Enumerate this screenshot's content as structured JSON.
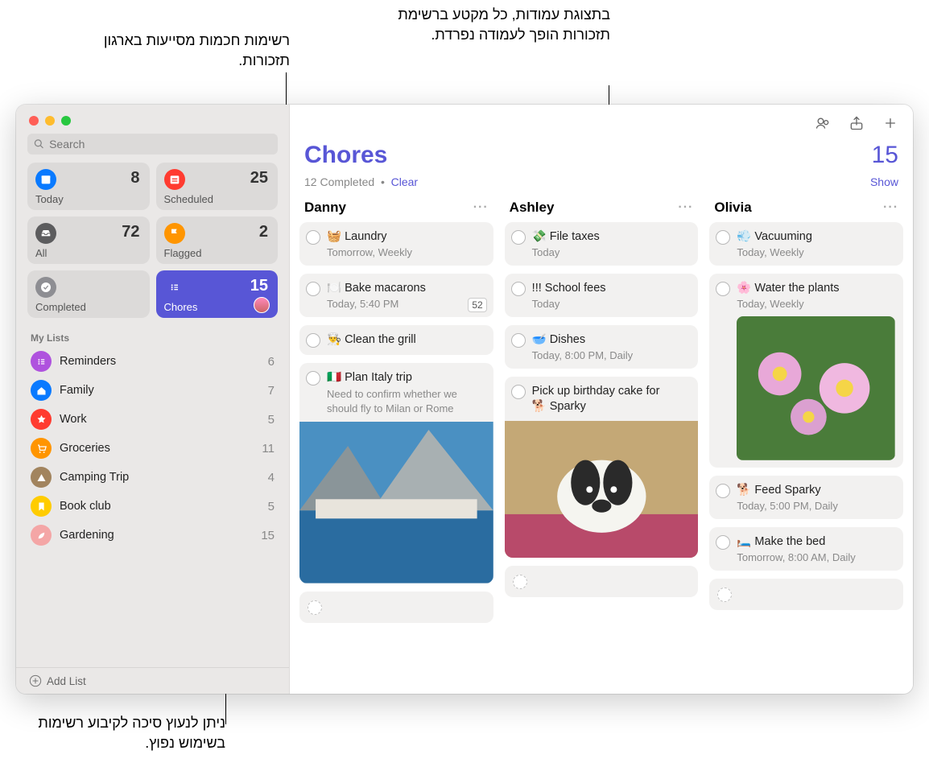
{
  "callouts": {
    "top_right": "בתצוגת עמודות, כל מקטע ברשימת תזכורות הופך לעמודה נפרדת.",
    "top_left": "רשימות חכמות מסייעות בארגון תזכורות.",
    "bottom": "ניתן לנעוץ סיכה לקיבוע רשימות בשימוש נפוץ."
  },
  "search": {
    "placeholder": "Search"
  },
  "smart": [
    {
      "id": "today",
      "label": "Today",
      "count": "8",
      "icon_bg": "#0a7aff",
      "glyph": "calendar"
    },
    {
      "id": "scheduled",
      "label": "Scheduled",
      "count": "25",
      "icon_bg": "#ff3b30",
      "glyph": "calendar-lines"
    },
    {
      "id": "all",
      "label": "All",
      "count": "72",
      "icon_bg": "#5c5c5e",
      "glyph": "tray"
    },
    {
      "id": "flagged",
      "label": "Flagged",
      "count": "2",
      "icon_bg": "#ff9500",
      "glyph": "flag"
    },
    {
      "id": "completed",
      "label": "Completed",
      "count": "",
      "icon_bg": "#8e8e93",
      "glyph": "check"
    },
    {
      "id": "chores",
      "label": "Chores",
      "count": "15",
      "icon_bg": "#5856d6",
      "glyph": "list",
      "active": true,
      "avatar": true
    }
  ],
  "my_lists_label": "My Lists",
  "lists": [
    {
      "name": "Reminders",
      "count": "6",
      "color": "#af52de",
      "glyph": "list"
    },
    {
      "name": "Family",
      "count": "7",
      "color": "#0a7aff",
      "glyph": "house"
    },
    {
      "name": "Work",
      "count": "5",
      "color": "#ff3b30",
      "glyph": "star"
    },
    {
      "name": "Groceries",
      "count": "11",
      "color": "#ff9500",
      "glyph": "cart"
    },
    {
      "name": "Camping Trip",
      "count": "4",
      "color": "#a2845e",
      "glyph": "tent"
    },
    {
      "name": "Book club",
      "count": "5",
      "color": "#ffcc00",
      "glyph": "bookmark"
    },
    {
      "name": "Gardening",
      "count": "15",
      "color": "#f4a6a6",
      "glyph": "leaf"
    }
  ],
  "add_list_label": "Add List",
  "main": {
    "title": "Chores",
    "count": "15",
    "completed_text": "12 Completed",
    "clear_label": "Clear",
    "show_label": "Show"
  },
  "columns": [
    {
      "name": "Danny",
      "cards": [
        {
          "emoji": "🧺",
          "title": "Laundry",
          "sub": "Tomorrow, Weekly"
        },
        {
          "emoji": "🍽️",
          "title": "Bake macarons",
          "sub": "Today, 5:40 PM",
          "tag": "52"
        },
        {
          "emoji": "👨‍🍳",
          "title": "Clean the grill"
        },
        {
          "emoji": "🇮🇹",
          "title": "Plan Italy trip",
          "note": "Need to confirm whether we should fly to Milan or Rome",
          "image": "coast"
        }
      ],
      "empty_trailing": true
    },
    {
      "name": "Ashley",
      "cards": [
        {
          "emoji": "💸",
          "title": "File taxes",
          "sub": "Today"
        },
        {
          "emoji": "",
          "title": "!!! School fees",
          "sub": "Today"
        },
        {
          "emoji": "🥣",
          "title": "Dishes",
          "sub": "Today, 8:00 PM, Daily"
        },
        {
          "emoji": "🐕",
          "title_pre": "Pick up birthday cake for ",
          "title_post": "Sparky",
          "image": "dog",
          "wrap": true
        }
      ],
      "empty_trailing": true
    },
    {
      "name": "Olivia",
      "cards": [
        {
          "emoji": "💨",
          "title": "Vacuuming",
          "sub": "Today, Weekly"
        },
        {
          "emoji": "🌸",
          "title": "Water the plants",
          "sub": "Today, Weekly",
          "image": "flowers",
          "image_inset": true
        },
        {
          "emoji": "🐕",
          "title": "Feed Sparky",
          "sub": "Today, 5:00 PM, Daily"
        },
        {
          "emoji": "🛏️",
          "title": "Make the bed",
          "sub": "Tomorrow, 8:00 AM, Daily"
        }
      ],
      "empty_trailing": true
    }
  ]
}
